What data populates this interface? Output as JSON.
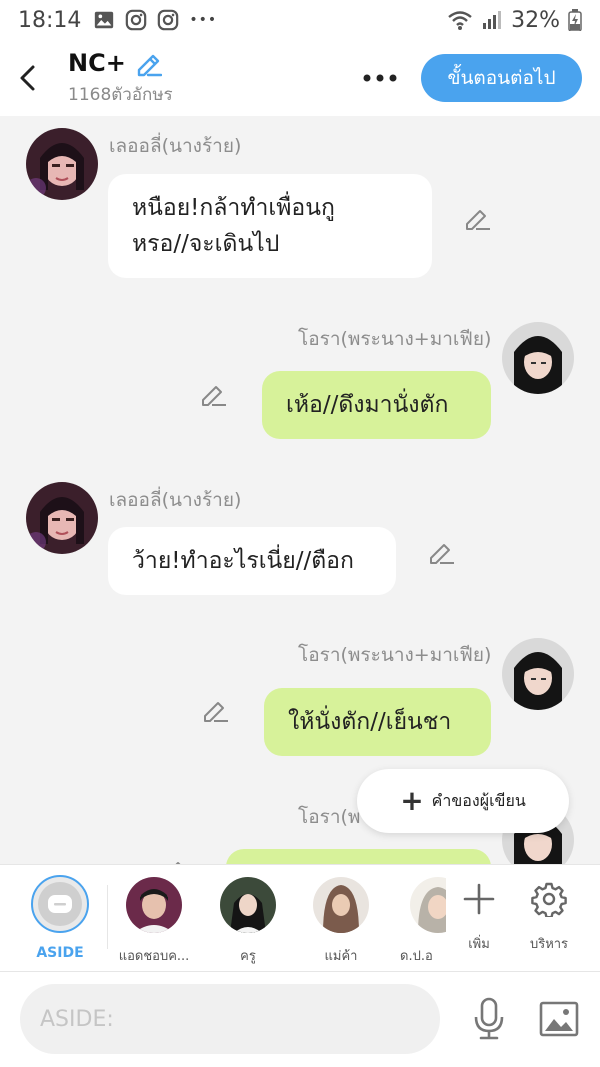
{
  "status_bar": {
    "time": "18:14",
    "battery": "32%",
    "more_dots": "•••"
  },
  "header": {
    "title": "NC+",
    "char_count": "1168ตัวอักษร",
    "next_button": "ขั้นตอนต่อไป"
  },
  "messages": [
    {
      "side": "left",
      "sender": "เลออลี่(นางร้าย)",
      "line1": "หนือย!กล้าทำเพื่อนกู",
      "line2": "หรอ//จะเดินไป"
    },
    {
      "side": "right",
      "sender": "โอรา(พระนาง+มาเฟีย)",
      "text": "เห้อ//ดึงมานั่งตัก"
    },
    {
      "side": "left",
      "sender": "เลออลี่(นางร้าย)",
      "text": "ว้าย!ทำอะไรเนี่ย//ตือก"
    },
    {
      "side": "right",
      "sender": "โอรา(พระนาง+มาเฟีย)",
      "text": "ให้นั่งตัก//เย็นชา"
    },
    {
      "side": "right",
      "sender": "โอรา(พ",
      "text": ""
    }
  ],
  "floating": {
    "author_note": "คำของผู้เขียน"
  },
  "characters": {
    "aside_label": "ASIDE",
    "items": [
      {
        "name": "แอดชอบค..."
      },
      {
        "name": "ครู"
      },
      {
        "name": "แม่ค้า"
      },
      {
        "name": "ด.ป.อ"
      }
    ],
    "add_label": "เพิ่ม",
    "manage_label": "บริหาร"
  },
  "input": {
    "placeholder": "ASIDE:"
  },
  "colors": {
    "accent": "#4aa3ee",
    "bubble_right": "#d7f29a",
    "bubble_left": "#ffffff",
    "background": "#f3f3f3"
  }
}
